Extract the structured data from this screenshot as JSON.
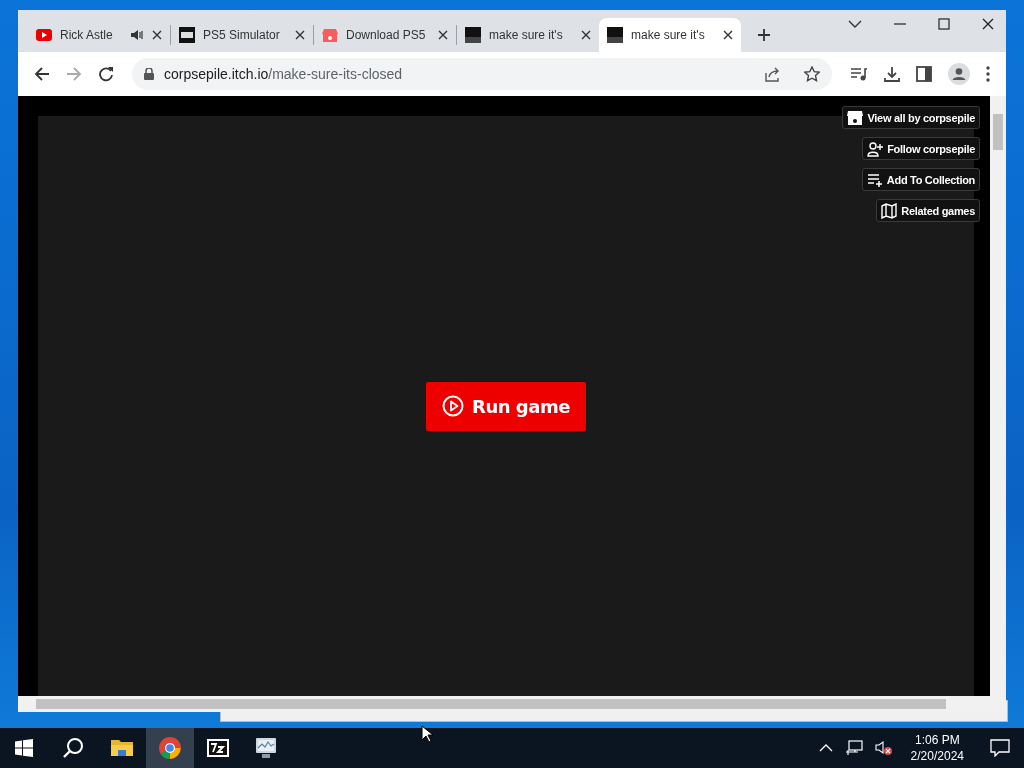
{
  "browser": {
    "tabs": [
      {
        "title": "Rick Astle",
        "audio": true,
        "selected": false
      },
      {
        "title": "PS5 Simulator",
        "audio": false,
        "selected": false
      },
      {
        "title": "Download PS5",
        "audio": false,
        "selected": false
      },
      {
        "title": "make sure it's",
        "audio": false,
        "selected": false
      },
      {
        "title": "make sure it's",
        "audio": false,
        "selected": true
      }
    ],
    "address": {
      "host": "corpsepile.itch.io",
      "path": "/make-sure-its-closed"
    }
  },
  "page": {
    "side_buttons": [
      {
        "label": "View all by corpsepile"
      },
      {
        "label": "Follow corpsepile"
      },
      {
        "label": "Add To Collection"
      },
      {
        "label": "Related games"
      }
    ],
    "run_button": "Run game"
  },
  "taskbar": {
    "apps": [
      {
        "kind": "explorer",
        "selected": false
      },
      {
        "kind": "chrome",
        "selected": true
      },
      {
        "kind": "sevenzip",
        "selected": false
      },
      {
        "kind": "monitor",
        "selected": false
      }
    ],
    "clock": {
      "time": "1:06 PM",
      "date": "2/20/2024"
    }
  }
}
